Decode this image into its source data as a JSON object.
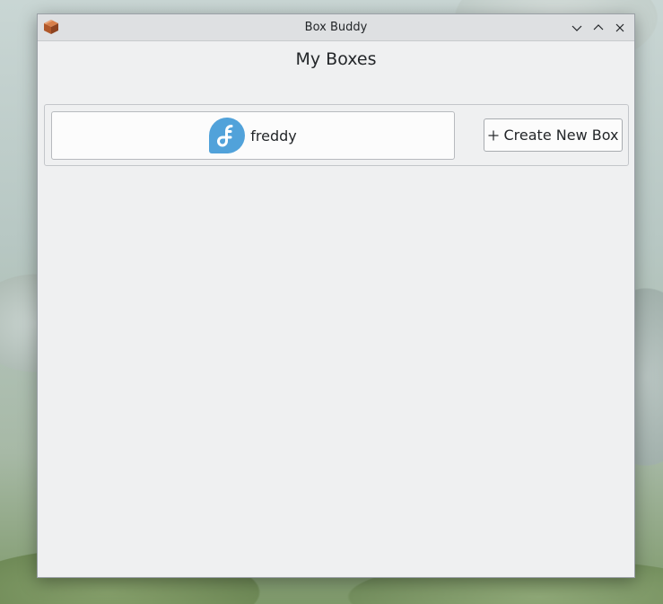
{
  "window": {
    "title": "Box Buddy"
  },
  "page": {
    "heading": "My Boxes"
  },
  "boxes": [
    {
      "name": "freddy",
      "icon": "fedora-icon"
    }
  ],
  "actions": {
    "create_label": "Create New Box"
  },
  "colors": {
    "fedora_blue": "#51a2da",
    "window_bg": "#eff0f1",
    "titlebar_bg": "#dee0e2"
  }
}
